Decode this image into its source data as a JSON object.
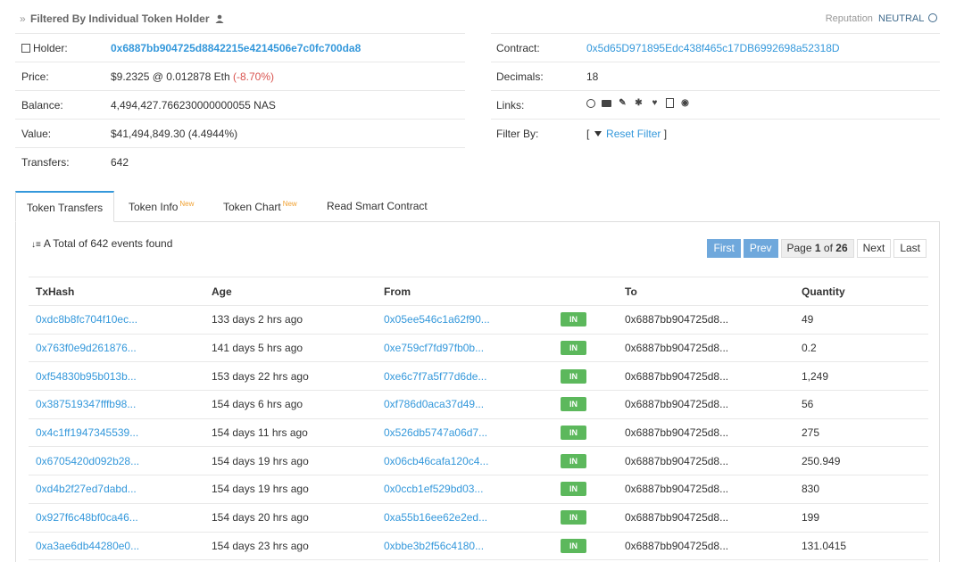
{
  "header": {
    "breadcrumb_prefix": "»",
    "breadcrumb": "Filtered By Individual Token Holder",
    "reputation_label": "Reputation",
    "reputation_value": "NEUTRAL"
  },
  "overview_left": {
    "holder": {
      "label": "Holder:",
      "value": "0x6887bb904725d8842215e4214506e7c0fc700da8"
    },
    "price": {
      "label": "Price:",
      "value": "$9.2325 @ 0.012878 Eth",
      "change": "(-8.70%)"
    },
    "balance": {
      "label": "Balance:",
      "value": "4,494,427.766230000000055 NAS"
    },
    "value": {
      "label": "Value:",
      "value": "$41,494,849.30 (4.4944%)"
    },
    "transfers": {
      "label": "Transfers:",
      "value": "642"
    }
  },
  "overview_right": {
    "contract": {
      "label": "Contract:",
      "value": "0x5d65D971895Edc438f465c17DB6992698a52318D"
    },
    "decimals": {
      "label": "Decimals:",
      "value": "18"
    },
    "links": {
      "label": "Links:",
      "icons": [
        "globe-icon",
        "mail-icon",
        "edit-icon",
        "slack-icon",
        "twitter-icon",
        "document-icon",
        "github-icon"
      ]
    },
    "filter": {
      "label": "Filter By:",
      "bracket_open": "[",
      "reset_label": "Reset Filter",
      "bracket_close": "]"
    }
  },
  "tabs": [
    {
      "label": "Token Transfers",
      "badge": ""
    },
    {
      "label": "Token Info",
      "badge": "New"
    },
    {
      "label": "Token Chart",
      "badge": "New"
    },
    {
      "label": "Read Smart Contract",
      "badge": ""
    }
  ],
  "transfers": {
    "total_text": "A Total of 642 events found",
    "pager": {
      "first": "First",
      "prev": "Prev",
      "page_word": "Page",
      "current": "1",
      "of_word": "of",
      "total_pages": "26",
      "next": "Next",
      "last": "Last"
    },
    "columns": [
      "TxHash",
      "Age",
      "From",
      "",
      "To",
      "Quantity"
    ],
    "rows": [
      {
        "tx": "0xdc8b8fc704f10ec...",
        "age": "133 days 2 hrs ago",
        "from": "0x05ee546c1a62f90...",
        "dir": "IN",
        "to": "0x6887bb904725d8...",
        "qty": "49"
      },
      {
        "tx": "0x763f0e9d261876...",
        "age": "141 days 5 hrs ago",
        "from": "0xe759cf7fd97fb0b...",
        "dir": "IN",
        "to": "0x6887bb904725d8...",
        "qty": "0.2"
      },
      {
        "tx": "0xf54830b95b013b...",
        "age": "153 days 22 hrs ago",
        "from": "0xe6c7f7a5f77d6de...",
        "dir": "IN",
        "to": "0x6887bb904725d8...",
        "qty": "1,249"
      },
      {
        "tx": "0x387519347fffb98...",
        "age": "154 days 6 hrs ago",
        "from": "0xf786d0aca37d49...",
        "dir": "IN",
        "to": "0x6887bb904725d8...",
        "qty": "56"
      },
      {
        "tx": "0x4c1ff1947345539...",
        "age": "154 days 11 hrs ago",
        "from": "0x526db5747a06d7...",
        "dir": "IN",
        "to": "0x6887bb904725d8...",
        "qty": "275"
      },
      {
        "tx": "0x6705420d092b28...",
        "age": "154 days 19 hrs ago",
        "from": "0x06cb46cafa120c4...",
        "dir": "IN",
        "to": "0x6887bb904725d8...",
        "qty": "250.949"
      },
      {
        "tx": "0xd4b2f27ed7dabd...",
        "age": "154 days 19 hrs ago",
        "from": "0x0ccb1ef529bd03...",
        "dir": "IN",
        "to": "0x6887bb904725d8...",
        "qty": "830"
      },
      {
        "tx": "0x927f6c48bf0ca46...",
        "age": "154 days 20 hrs ago",
        "from": "0xa55b16ee62e2ed...",
        "dir": "IN",
        "to": "0x6887bb904725d8...",
        "qty": "199"
      },
      {
        "tx": "0xa3ae6db44280e0...",
        "age": "154 days 23 hrs ago",
        "from": "0xbbe3b2f56c4180...",
        "dir": "IN",
        "to": "0x6887bb904725d8...",
        "qty": "131.0415"
      }
    ]
  },
  "colors": {
    "link": "#3498db",
    "in_badge": "#5cb85c",
    "negative": "#d9534f",
    "pager_active": "#6fa8dc",
    "tab_accent": "#3498db"
  }
}
